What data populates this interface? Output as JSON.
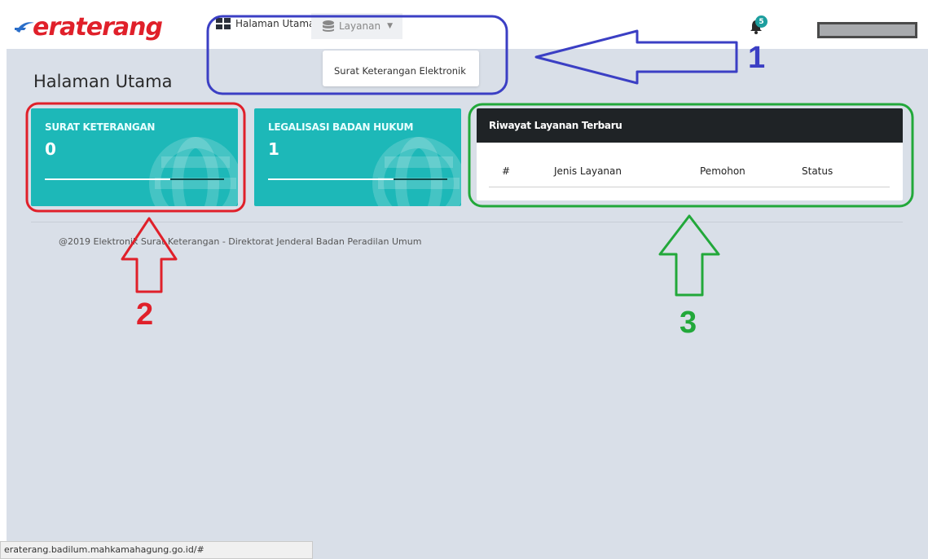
{
  "brand": {
    "logo_text": "eraterang"
  },
  "nav": {
    "home_label": "Halaman Utama",
    "layanan_label": "Layanan",
    "dropdown_items": [
      "Surat Keterangan Elektronik"
    ]
  },
  "notifications": {
    "count": "5"
  },
  "page": {
    "title": "Halaman Utama"
  },
  "cards": [
    {
      "label": "SURAT KETERANGAN",
      "value": "0",
      "progress": 0.7
    },
    {
      "label": "LEGALISASI BADAN HUKUM",
      "value": "1",
      "progress": 0.7
    }
  ],
  "history_panel": {
    "title": "Riwayat Layanan Terbaru",
    "columns": [
      "#",
      "Jenis Layanan",
      "Pemohon",
      "Status"
    ]
  },
  "footer": {
    "text": "@2019 Elektronik Surat Keterangan - Direktorat Jenderal Badan Peradilan Umum"
  },
  "status_bar": {
    "url": "eraterang.badilum.mahkamahagung.go.id/#"
  },
  "annotations": {
    "labels": [
      "1",
      "2",
      "3"
    ],
    "colors": {
      "1": "#3b3fc4",
      "2": "#e0202a",
      "3": "#22a83a"
    }
  },
  "icons": [
    "logo-swoosh-icon",
    "grid-icon",
    "database-icon",
    "chevron-down-icon",
    "bell-icon",
    "globe-icon"
  ]
}
